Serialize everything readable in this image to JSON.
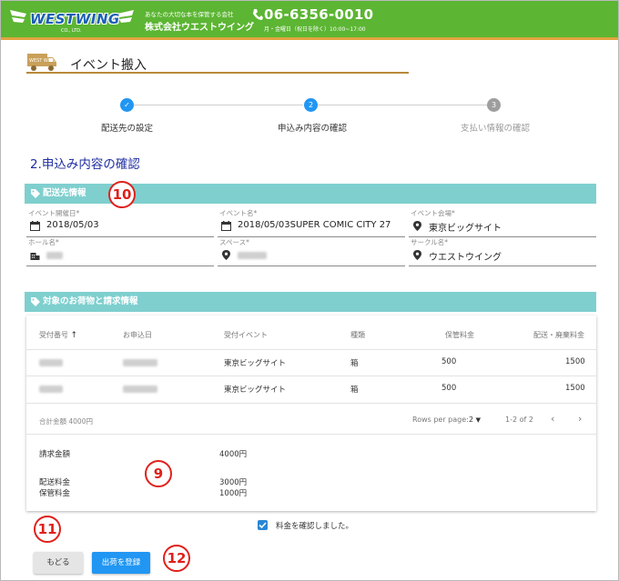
{
  "colors": {
    "header_bg": "#5cb533",
    "accent_blue": "#2196f3",
    "bar_teal": "#7fcfcf",
    "badge_red": "#e0201a"
  },
  "header": {
    "logo_text": "WESTWING",
    "logo_sub": "CO., LTD.",
    "tagline": "あなたの大切な本を保管する会社",
    "company": "株式会社ウエストウイング",
    "phone": "06-6356-0010",
    "hours": "月・金曜日（祝日を除く）10:00~17:00"
  },
  "page": {
    "title": "イベント搬入",
    "truck_label": "WEST WING"
  },
  "stepper": {
    "steps": [
      {
        "label": "配送先の設定",
        "num": "✓",
        "state": "done"
      },
      {
        "label": "申込み内容の確認",
        "num": "2",
        "state": "active"
      },
      {
        "label": "支払い情報の確認",
        "num": "3",
        "state": "pending"
      }
    ]
  },
  "section": {
    "heading": "2.申込み内容の確認"
  },
  "delivery": {
    "bar_title": "配送先情報",
    "badge": "10",
    "fields": {
      "event_date": {
        "label": "イベント開催日*",
        "value": "2018/05/03"
      },
      "event_name": {
        "label": "イベント名*",
        "value": "2018/05/03SUPER COMIC CITY 27"
      },
      "venue": {
        "label": "イベント会場*",
        "value": "東京ビッグサイト"
      },
      "hall": {
        "label": "ホール名*",
        "value": ""
      },
      "space": {
        "label": "スペース*",
        "value": ""
      },
      "circle": {
        "label": "サークル名*",
        "value": "ウエストウイング"
      }
    }
  },
  "items": {
    "bar_title": "対象のお荷物と請求情報",
    "columns": [
      "受付番号",
      "お申込日",
      "受付イベント",
      "種類",
      "保管料金",
      "配送・廃棄料金"
    ],
    "sort_arrow": "↑",
    "rows": [
      {
        "event": "東京ビッグサイト",
        "kind": "箱",
        "storage": "500",
        "delivery": "1500"
      },
      {
        "event": "東京ビッグサイト",
        "kind": "箱",
        "storage": "500",
        "delivery": "1500"
      }
    ],
    "total": "合計金額 4000円",
    "rows_per_page_label": "Rows per page:",
    "rows_per_page": "2",
    "range": "1-2 of 2",
    "summary": {
      "billing_label": "請求金額",
      "billing_value": "4000円",
      "delivery_label": "配送料金",
      "delivery_value": "3000円",
      "storage_label": "保管料金",
      "storage_value": "1000円"
    },
    "badge": "9"
  },
  "confirm": {
    "label": "料金を確認しました。",
    "badge": "11"
  },
  "buttons": {
    "back": "もどる",
    "submit": "出荷を登録",
    "badge": "12"
  }
}
